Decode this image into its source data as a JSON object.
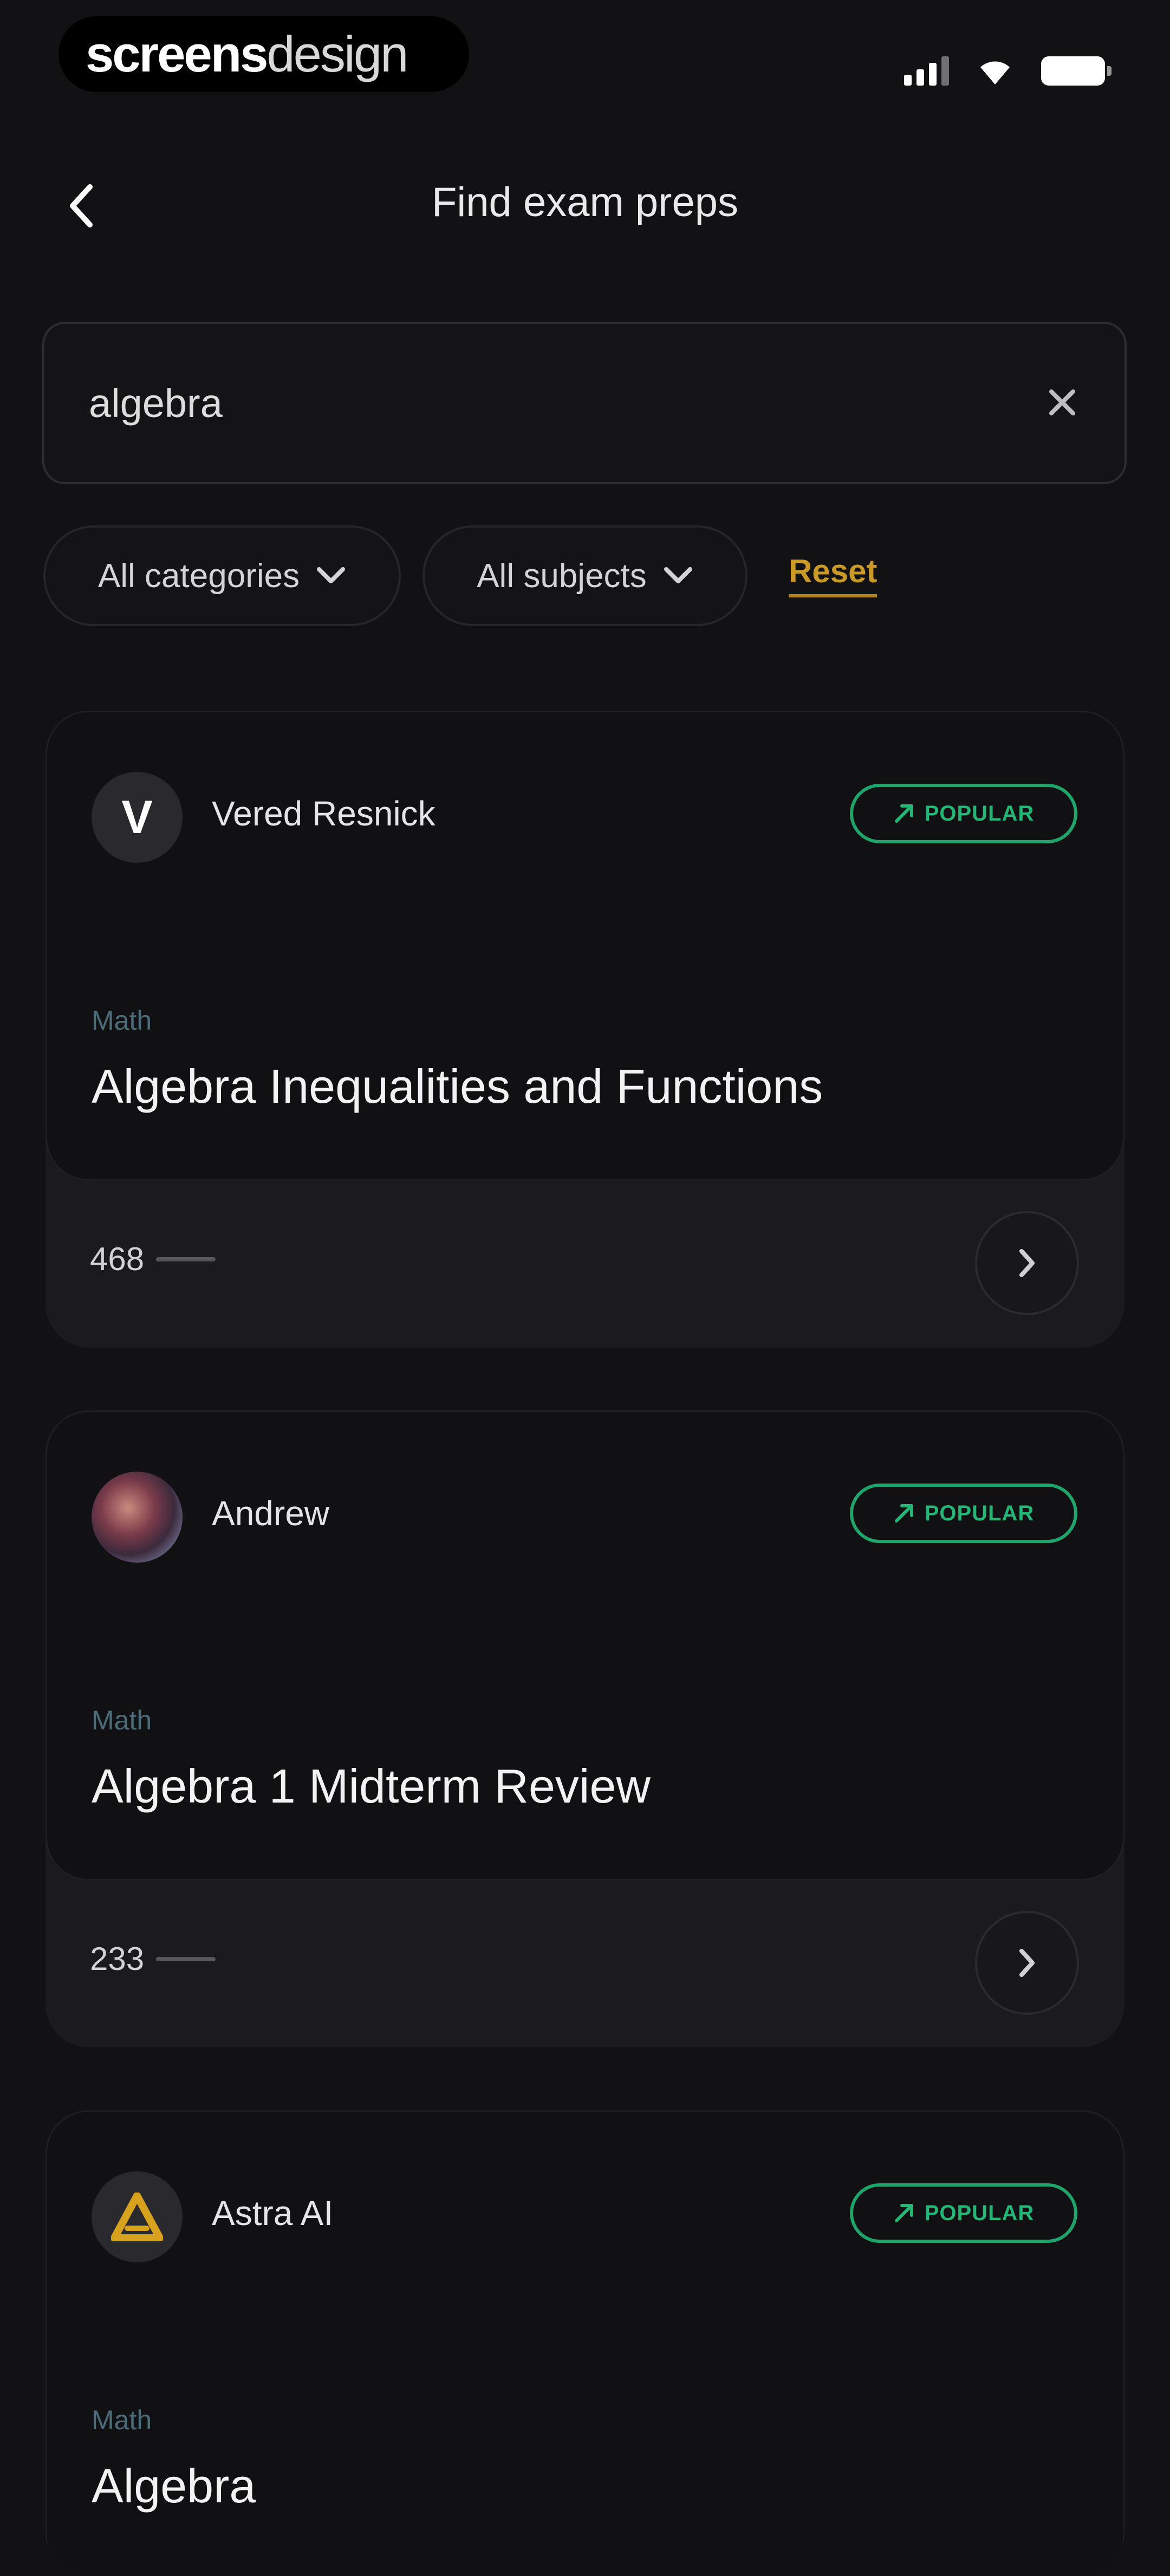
{
  "status_bar": {
    "brand_strong": "screens",
    "brand_light": "design"
  },
  "header": {
    "title": "Find exam preps"
  },
  "search": {
    "value": "algebra",
    "placeholder": ""
  },
  "filters": {
    "categories_label": "All categories",
    "subjects_label": "All subjects",
    "reset_label": "Reset"
  },
  "results": [
    {
      "author": "Vered Resnick",
      "avatar_letter": "V",
      "badge": "POPULAR",
      "category": "Math",
      "title": "Algebra Inequalities and Functions",
      "count": "468"
    },
    {
      "author": "Andrew",
      "badge": "POPULAR",
      "category": "Math",
      "title": "Algebra 1 Midterm Review",
      "count": "233"
    },
    {
      "author": "Astra AI",
      "badge": "POPULAR",
      "category": "Math",
      "title": "Algebra"
    }
  ],
  "colors": {
    "background": "#121214",
    "accent_green": "#24b676",
    "reset_gold": "#c99a28"
  },
  "icons": {
    "back": "chevron-left-icon",
    "clear": "close-icon",
    "dropdown": "chevron-down-icon",
    "trend": "trending-up-icon",
    "next": "chevron-right-icon"
  }
}
